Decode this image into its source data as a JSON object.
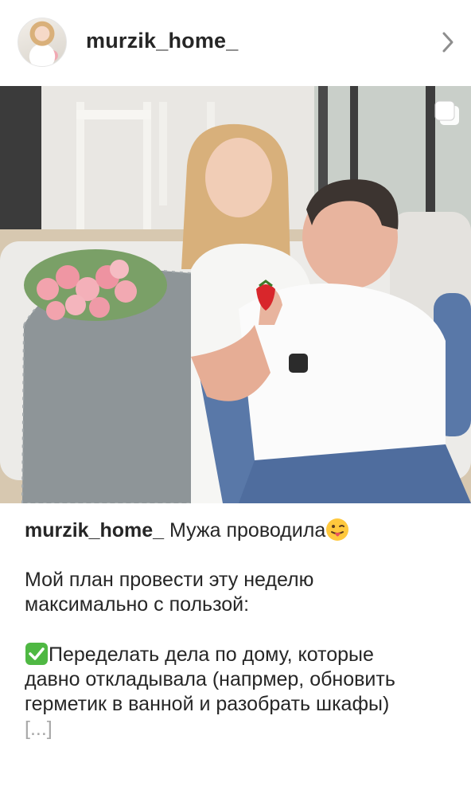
{
  "header": {
    "username": "murzik_home_",
    "avatar_icon": "profile-avatar",
    "chevron_icon": "chevron-right-icon"
  },
  "post": {
    "photo_description_icon": "photo",
    "multi_icon": "carousel-multiple-icon"
  },
  "caption": {
    "username": "murzik_home_",
    "first_text": "Мужа проводила",
    "first_emoji_icon": "tongue-out-emoji",
    "paragraph1_line1": "Мой план провести эту неделю",
    "paragraph1_line2": "максимально с пользой:",
    "check_emoji_icon": "check-mark-emoji",
    "paragraph2_line1": "Переделать дела по дому, которые",
    "paragraph2_line2": "давно откладывала (напрмер, обновить",
    "paragraph2_line3": "герметик в ванной и разобрать шкафы)",
    "more_label": "[...]"
  },
  "colors": {
    "text": "#262626",
    "muted": "#a8a8a8",
    "check_green": "#4fb843"
  }
}
